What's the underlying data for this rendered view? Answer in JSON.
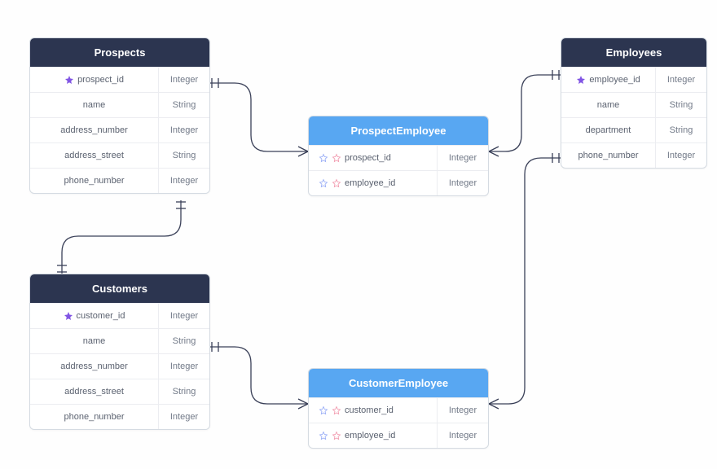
{
  "entities": {
    "prospects": {
      "title": "Prospects",
      "rows": [
        {
          "name": "prospect_id",
          "type": "Integer",
          "pk": true
        },
        {
          "name": "name",
          "type": "String"
        },
        {
          "name": "address_number",
          "type": "Integer"
        },
        {
          "name": "address_street",
          "type": "String"
        },
        {
          "name": "phone_number",
          "type": "Integer"
        }
      ]
    },
    "employees": {
      "title": "Employees",
      "rows": [
        {
          "name": "employee_id",
          "type": "Integer",
          "pk": true
        },
        {
          "name": "name",
          "type": "String"
        },
        {
          "name": "department",
          "type": "String"
        },
        {
          "name": "phone_number",
          "type": "Integer"
        }
      ]
    },
    "customers": {
      "title": "Customers",
      "rows": [
        {
          "name": "customer_id",
          "type": "Integer",
          "pk": true
        },
        {
          "name": "name",
          "type": "String"
        },
        {
          "name": "address_number",
          "type": "Integer"
        },
        {
          "name": "address_street",
          "type": "String"
        },
        {
          "name": "phone_number",
          "type": "Integer"
        }
      ]
    },
    "prospect_employee": {
      "title": "ProspectEmployee",
      "rows": [
        {
          "name": "prospect_id",
          "type": "Integer",
          "fk": true
        },
        {
          "name": "employee_id",
          "type": "Integer",
          "fk": true
        }
      ]
    },
    "customer_employee": {
      "title": "CustomerEmployee",
      "rows": [
        {
          "name": "customer_id",
          "type": "Integer",
          "fk": true
        },
        {
          "name": "employee_id",
          "type": "Integer",
          "fk": true
        }
      ]
    }
  },
  "relationships": [
    {
      "from": "prospects",
      "to": "prospect_employee",
      "type": "one-to-many"
    },
    {
      "from": "employees",
      "to": "prospect_employee",
      "type": "one-to-many"
    },
    {
      "from": "prospects",
      "to": "customers",
      "type": "one-to-one"
    },
    {
      "from": "customers",
      "to": "customer_employee",
      "type": "one-to-many"
    },
    {
      "from": "employees",
      "to": "customer_employee",
      "type": "one-to-many"
    }
  ],
  "colors": {
    "header_dark": "#2c3550",
    "header_blue": "#58a7f2",
    "pk_star": "#8155e4",
    "fk_star_a": "#8ea4f5",
    "fk_star_b": "#f08fa6"
  }
}
